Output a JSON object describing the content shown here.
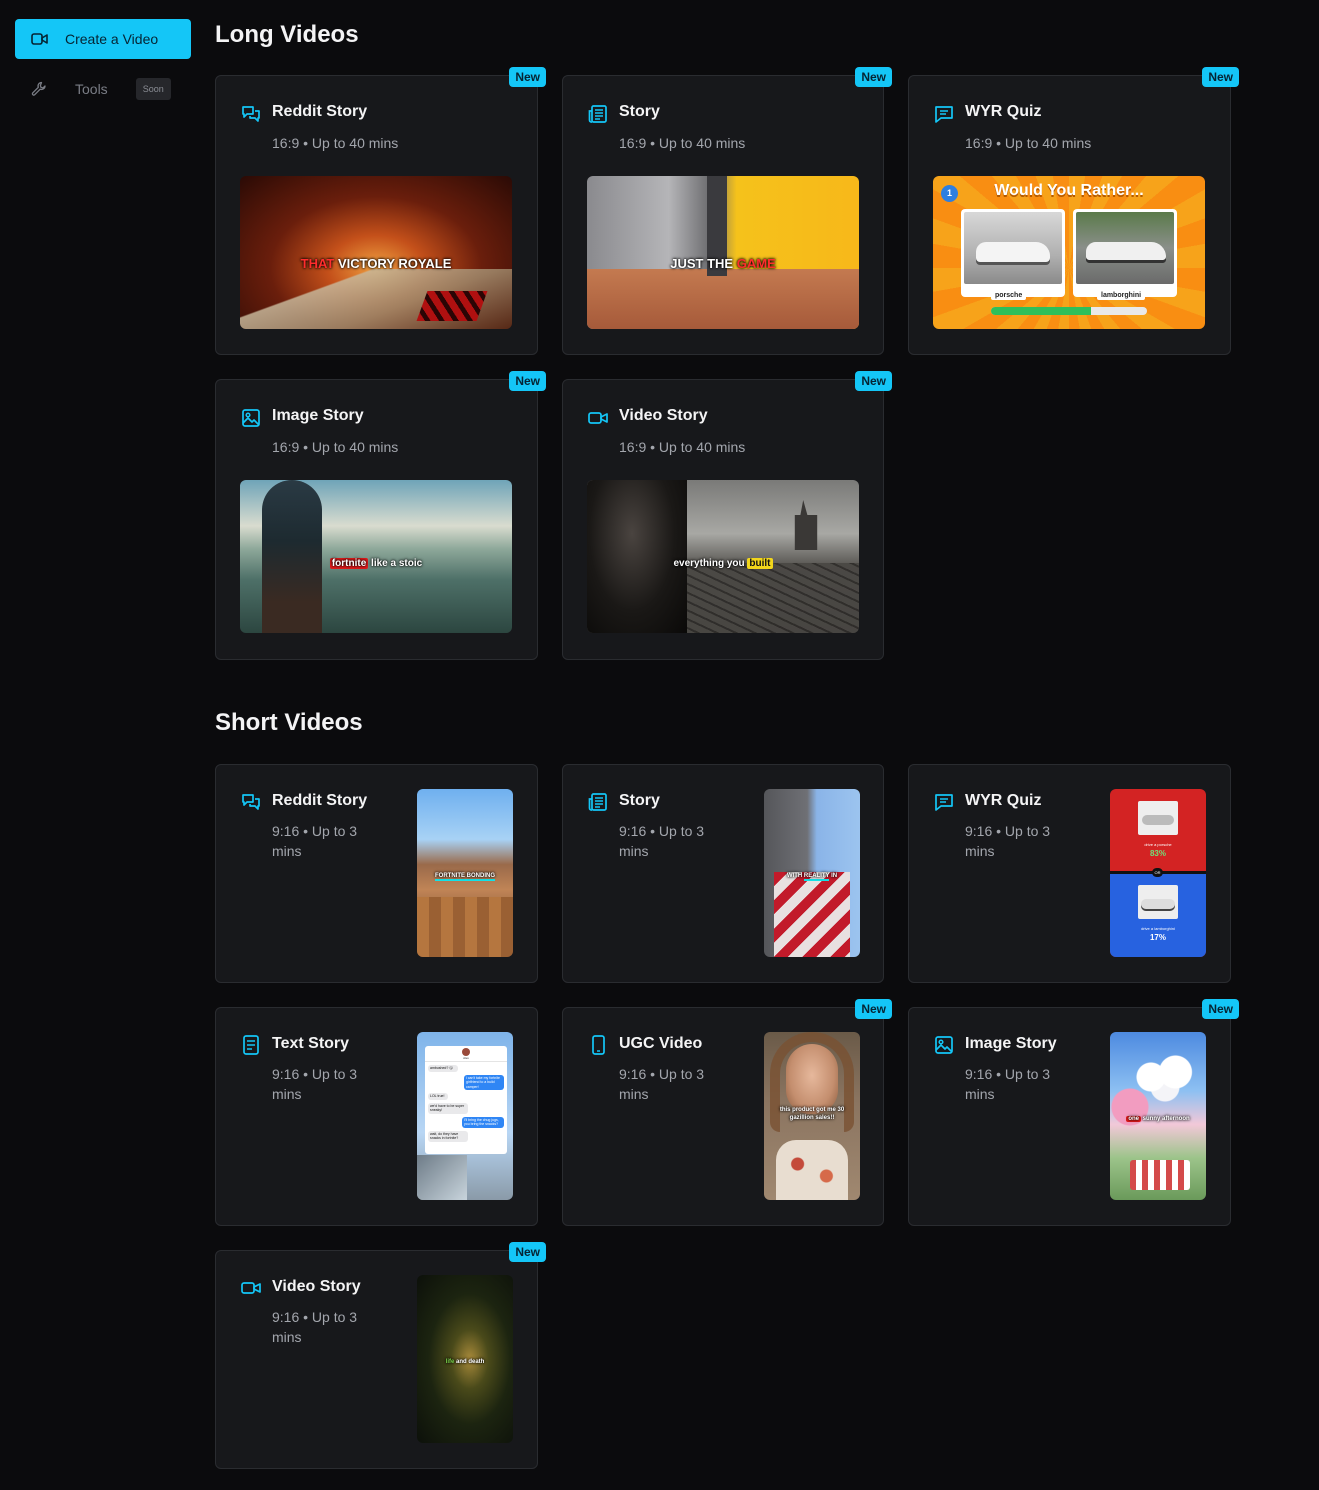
{
  "sidebar": {
    "create_label": "Create a Video",
    "tools_label": "Tools",
    "soon_label": "Soon"
  },
  "badge_label": "New",
  "long": {
    "title": "Long Videos",
    "cards": [
      {
        "title": "Reddit Story",
        "meta": "16:9 • Up to 40 mins",
        "caption_a": "THAT",
        "caption_b": " VICTORY ROYALE"
      },
      {
        "title": "Story",
        "meta": "16:9 • Up to 40 mins",
        "caption_a": "JUST THE ",
        "caption_b": "GAME"
      },
      {
        "title": "WYR Quiz",
        "meta": "16:9 • Up to 40 mins",
        "wyr_title": "Would You Rather...",
        "wyr_num": "1",
        "opt1": "porsche",
        "opt2": "lamborghini"
      },
      {
        "title": "Image Story",
        "meta": "16:9 • Up to 40 mins",
        "caption_a": "fortnite",
        "caption_b": " like a stoic"
      },
      {
        "title": "Video Story",
        "meta": "16:9 • Up to 40 mins",
        "caption_a": "everything you ",
        "caption_b": "built"
      }
    ]
  },
  "short": {
    "title": "Short Videos",
    "cards": [
      {
        "title": "Reddit Story",
        "meta": "9:16 • Up to 3 mins",
        "caption": "FORTNITE BONDING"
      },
      {
        "title": "Story",
        "meta": "9:16 • Up to 3 mins",
        "caption_a": "WITH ",
        "caption_b": "REALITY",
        "caption_c": " IN"
      },
      {
        "title": "WYR Quiz",
        "meta": "9:16 • Up to 3 mins",
        "top_label": "drive a porsche",
        "top_pct": "83%",
        "or_label": "OR",
        "bottom_label": "drive a lamborghini",
        "bottom_pct": "17%"
      },
      {
        "title": "Text Story",
        "meta": "9:16 • Up to 3 mins",
        "chat_name": "Alex",
        "msgs": [
          "ambushed? 😏",
          "i can't take my fortnite girlfriend to a build camper!",
          "LOL true!",
          "we'd have to be super sneaky!",
          "I'll bring the chug jugs, you bring the snacks?",
          "wait, do they have snacks in fortnite?"
        ]
      },
      {
        "title": "UGC Video",
        "meta": "9:16 • Up to 3 mins",
        "caption": "this product got me 30 gazillion sales!!"
      },
      {
        "title": "Image Story",
        "meta": "9:16 • Up to 3 mins",
        "caption_a": "one",
        "caption_b": " sunny afternoon"
      },
      {
        "title": "Video Story",
        "meta": "9:16 • Up to 3 mins",
        "caption_a": "life",
        "caption_b": " and death"
      }
    ]
  }
}
